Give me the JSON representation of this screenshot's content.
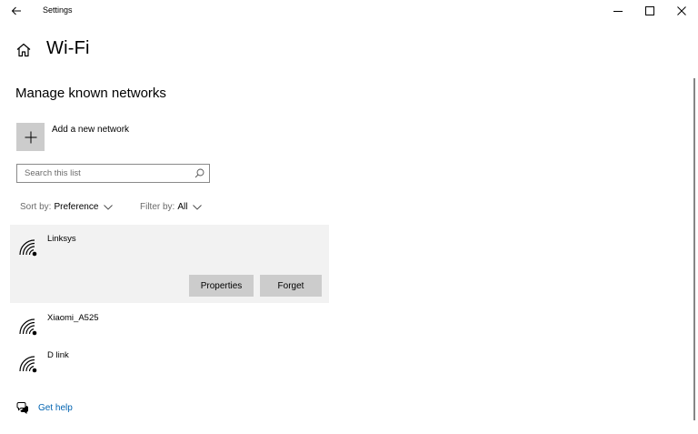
{
  "titlebar": {
    "title": "Settings",
    "back_icon": "back-arrow-icon",
    "minimize_icon": "minimize-icon",
    "maximize_icon": "maximize-icon",
    "close_icon": "close-icon"
  },
  "header": {
    "home_icon": "home-icon",
    "title": "Wi-Fi"
  },
  "section": {
    "title": "Manage known networks"
  },
  "add_network": {
    "icon": "plus-icon",
    "label": "Add a new network"
  },
  "search": {
    "placeholder": "Search this list",
    "value": "",
    "icon": "search-icon"
  },
  "sort": {
    "label": "Sort by:",
    "value": "Preference"
  },
  "filter": {
    "label": "Filter by:",
    "value": "All"
  },
  "networks": [
    {
      "name": "Linksys",
      "icon": "wifi-secured-icon",
      "selected": true
    },
    {
      "name": "Xiaomi_A525",
      "icon": "wifi-secured-icon",
      "selected": false
    },
    {
      "name": "D link",
      "icon": "wifi-secured-icon",
      "selected": false
    }
  ],
  "selected_actions": {
    "properties_label": "Properties",
    "forget_label": "Forget"
  },
  "help": {
    "icon": "help-chat-icon",
    "label": "Get help"
  },
  "colors": {
    "accent": "#0063b1",
    "button_bg": "#cccccc",
    "selected_bg": "#f2f2f2"
  }
}
